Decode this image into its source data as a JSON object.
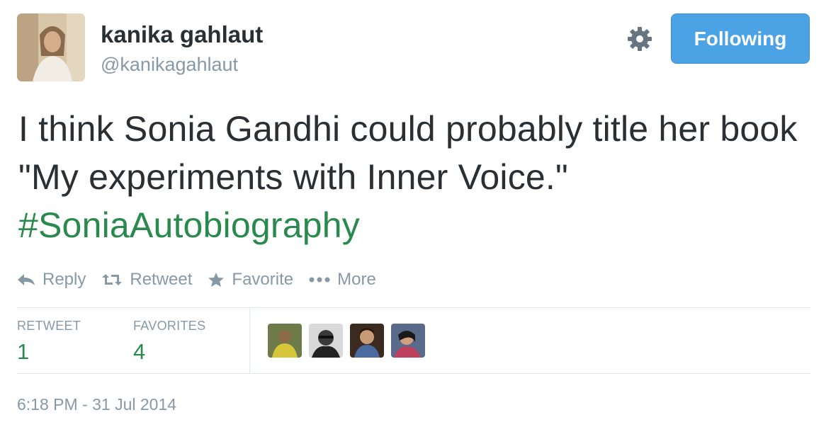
{
  "author": {
    "display_name": "kanika gahlaut",
    "handle": "@kanikagahlaut"
  },
  "follow_button": {
    "label": "Following",
    "color": "#4ba2e4"
  },
  "tweet": {
    "text": "I think Sonia Gandhi could probably title her book \"My experiments with Inner Voice.\"",
    "hashtag": "#SoniaAutobiography",
    "hashtag_color": "#2a8a4e"
  },
  "actions": {
    "reply": {
      "label": "Reply",
      "icon": "reply-icon"
    },
    "retweet": {
      "label": "Retweet",
      "icon": "retweet-icon"
    },
    "favorite": {
      "label": "Favorite",
      "icon": "star-icon"
    },
    "more": {
      "label": "More",
      "icon": "ellipsis-icon"
    }
  },
  "stats": {
    "retweets": {
      "label": "RETWEET",
      "value": "1"
    },
    "favorites": {
      "label": "FAVORITES",
      "value": "4"
    }
  },
  "timestamp": "6:18 PM - 31 Jul 2014"
}
